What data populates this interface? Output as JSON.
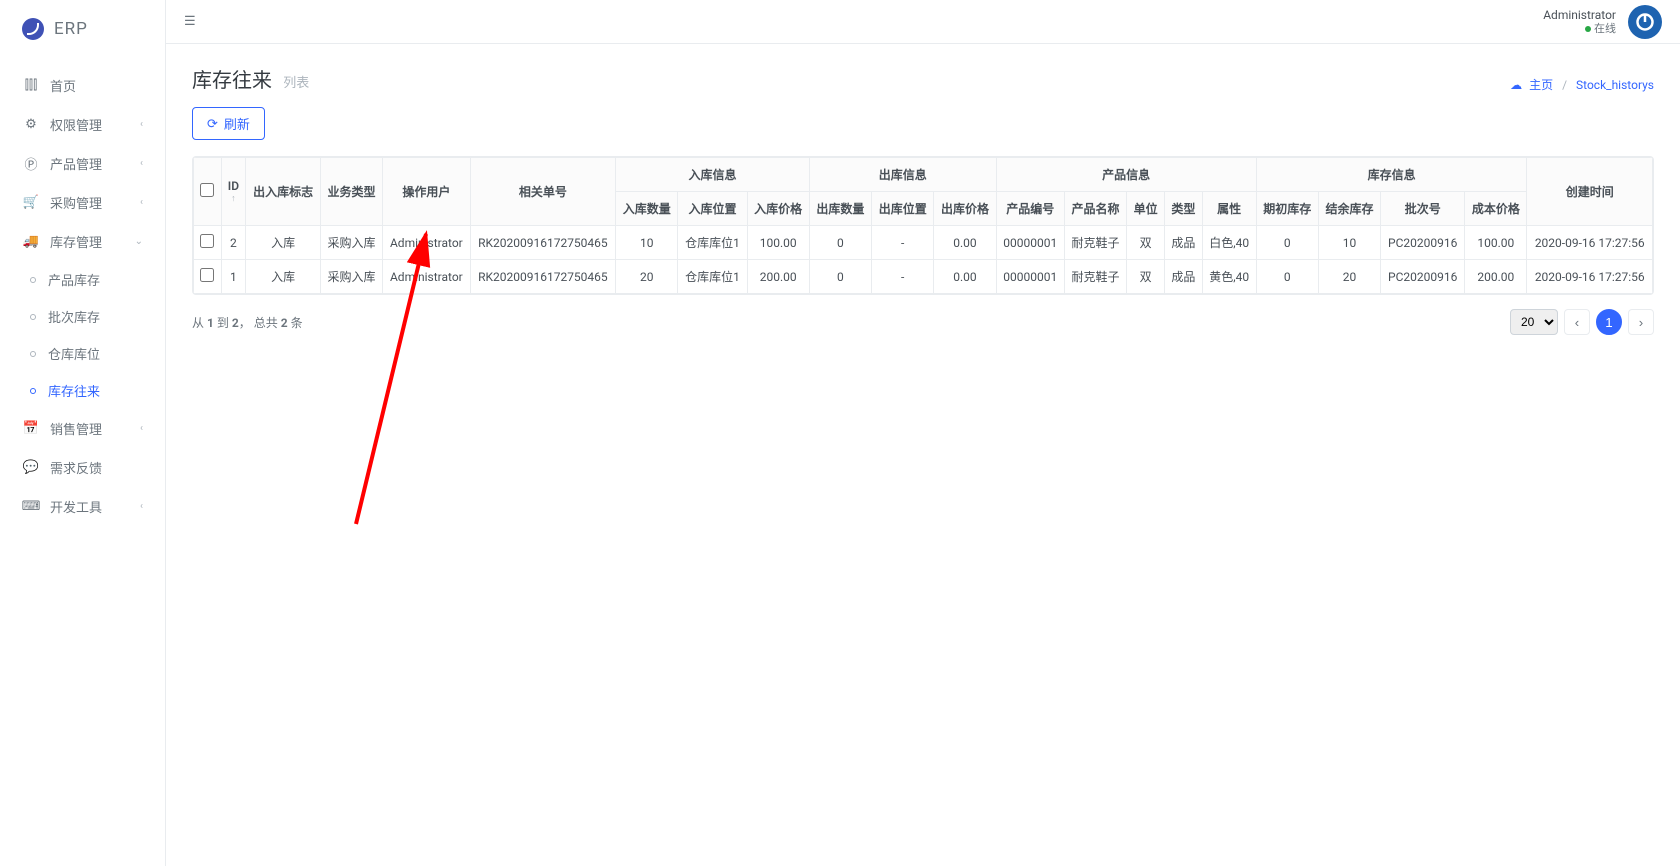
{
  "brand": "ERP",
  "user": {
    "name": "Administrator",
    "status": "在线"
  },
  "sidebar": {
    "items": [
      {
        "label": "首页"
      },
      {
        "label": "权限管理",
        "expandable": true
      },
      {
        "label": "产品管理",
        "expandable": true
      },
      {
        "label": "采购管理",
        "expandable": true
      },
      {
        "label": "库存管理",
        "expandable": true,
        "expanded": true
      },
      {
        "label": "销售管理",
        "expandable": true
      },
      {
        "label": "需求反馈"
      },
      {
        "label": "开发工具",
        "expandable": true
      }
    ],
    "stock_sub": [
      {
        "label": "产品库存"
      },
      {
        "label": "批次库存"
      },
      {
        "label": "仓库库位"
      },
      {
        "label": "库存往来",
        "active": true
      }
    ]
  },
  "page": {
    "title": "库存往来",
    "subtitle": "列表"
  },
  "breadcrumb": {
    "home": "主页",
    "current": "Stock_historys"
  },
  "actions": {
    "refresh": "刷新"
  },
  "table": {
    "group_headers": {
      "in": "入库信息",
      "out": "出库信息",
      "product": "产品信息",
      "stock": "库存信息"
    },
    "headers": {
      "id": "ID",
      "flag": "出入库标志",
      "biz_type": "业务类型",
      "operator": "操作用户",
      "doc_no": "相关单号",
      "in_qty": "入库数量",
      "in_loc": "入库位置",
      "in_price": "入库价格",
      "out_qty": "出库数量",
      "out_loc": "出库位置",
      "out_price": "出库价格",
      "prod_code": "产品编号",
      "prod_name": "产品名称",
      "unit": "单位",
      "type": "类型",
      "attr": "属性",
      "init_stock": "期初库存",
      "remain_stock": "结余库存",
      "batch_no": "批次号",
      "cost_price": "成本价格",
      "created": "创建时间"
    },
    "rows": [
      {
        "id": "2",
        "flag": "入库",
        "biz_type": "采购入库",
        "operator": "Administrator",
        "doc_no": "RK20200916172750465",
        "in_qty": "10",
        "in_loc": "仓库库位1",
        "in_price": "100.00",
        "out_qty": "0",
        "out_loc": "-",
        "out_price": "0.00",
        "prod_code": "00000001",
        "prod_name": "耐克鞋子",
        "unit": "双",
        "type": "成品",
        "attr": "白色,40",
        "init_stock": "0",
        "remain_stock": "10",
        "batch_no": "PC20200916",
        "cost_price": "100.00",
        "created": "2020-09-16 17:27:56"
      },
      {
        "id": "1",
        "flag": "入库",
        "biz_type": "采购入库",
        "operator": "Administrator",
        "doc_no": "RK20200916172750465",
        "in_qty": "20",
        "in_loc": "仓库库位1",
        "in_price": "200.00",
        "out_qty": "0",
        "out_loc": "-",
        "out_price": "0.00",
        "prod_code": "00000001",
        "prod_name": "耐克鞋子",
        "unit": "双",
        "type": "成品",
        "attr": "黄色,40",
        "init_stock": "0",
        "remain_stock": "20",
        "batch_no": "PC20200916",
        "cost_price": "200.00",
        "created": "2020-09-16 17:27:56"
      }
    ]
  },
  "footer": {
    "summary_prefix": "从 ",
    "summary_mid": " 到 ",
    "summary_sep": "， 总共 ",
    "summary_suffix": " 条",
    "from": "1",
    "to": "2",
    "total": "2"
  },
  "pager": {
    "page_size": "20",
    "current": "1"
  }
}
